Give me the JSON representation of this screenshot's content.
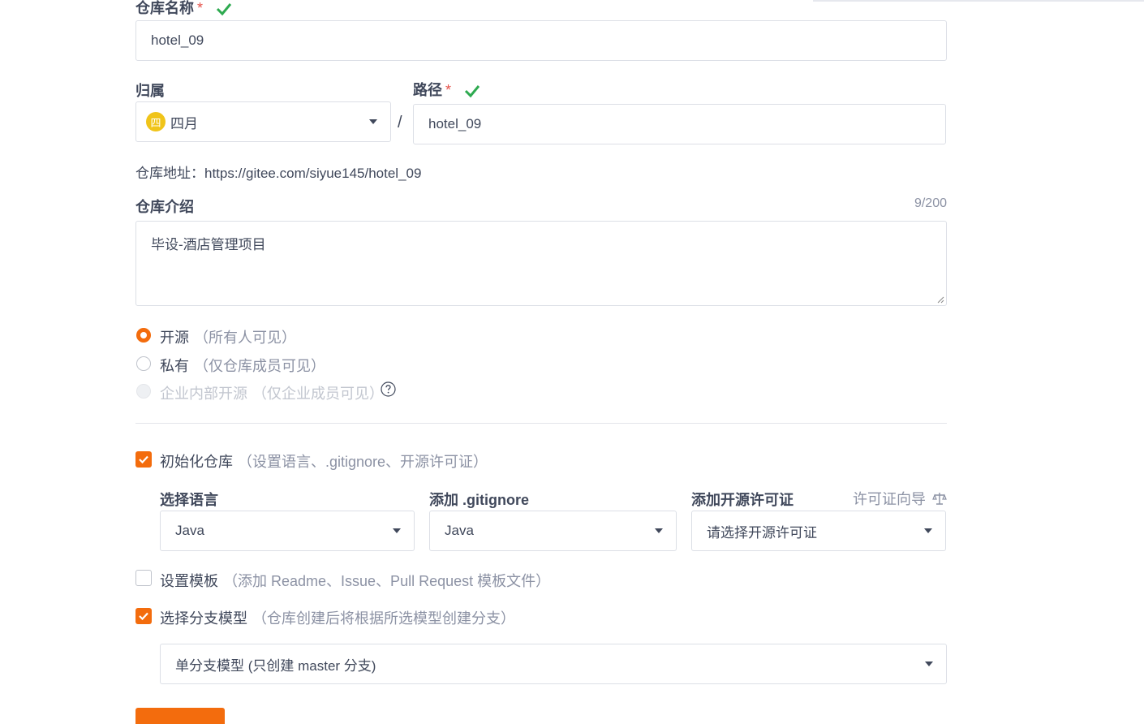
{
  "repo_name": {
    "label": "仓库名称",
    "required": "*",
    "value": "hotel_09"
  },
  "owner": {
    "label": "归属",
    "avatar_char": "四",
    "value": "四月"
  },
  "separator": "/",
  "path": {
    "label": "路径",
    "required": "*",
    "value": "hotel_09"
  },
  "repo_url": {
    "text": "仓库地址：https://gitee.com/siyue145/hotel_09"
  },
  "description": {
    "label": "仓库介绍",
    "counter": "9/200",
    "value": "毕设-酒店管理项目"
  },
  "visibility": {
    "options": [
      {
        "label": "开源",
        "hint": "（所有人可见）",
        "selected": true
      },
      {
        "label": "私有",
        "hint": "（仅仓库成员可见）",
        "selected": false
      },
      {
        "label": "企业内部开源",
        "hint": "（仅企业成员可见）",
        "disabled": true
      }
    ]
  },
  "init_repo": {
    "label": "初始化仓库",
    "hint": "（设置语言、.gitignore、开源许可证）",
    "checked": true
  },
  "language": {
    "label": "选择语言",
    "value": "Java"
  },
  "gitignore": {
    "label": "添加 .gitignore",
    "value": "Java"
  },
  "license": {
    "label": "添加开源许可证",
    "guide": "许可证向导",
    "placeholder": "请选择开源许可证"
  },
  "template": {
    "label": "设置模板",
    "hint": "（添加 Readme、Issue、Pull Request 模板文件）",
    "checked": false
  },
  "branch_model": {
    "label": "选择分支模型",
    "hint": "（仓库创建后将根据所选模型创建分支）",
    "checked": true,
    "value": "单分支模型 (只创建 master 分支)"
  },
  "colors": {
    "accent": "#f36c0d",
    "success": "#2eaa50",
    "border": "#dcdfe6"
  }
}
